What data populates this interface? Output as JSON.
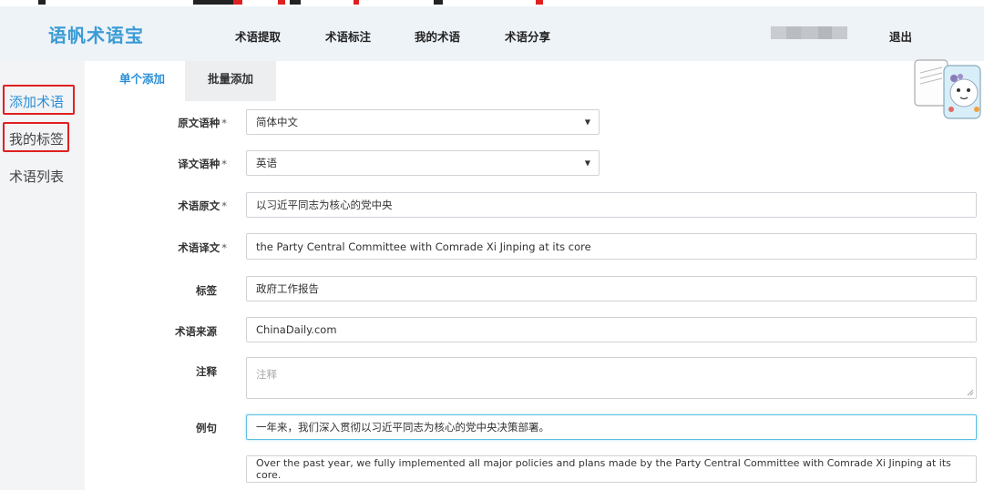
{
  "header": {
    "logo": "语帆术语宝",
    "nav": [
      "术语提取",
      "术语标注",
      "我的术语",
      "术语分享"
    ],
    "logout": "退出"
  },
  "sidebar": {
    "items": [
      {
        "label": "添加术语",
        "active": true,
        "highlighted": true
      },
      {
        "label": "我的标签",
        "active": false,
        "highlighted": true
      },
      {
        "label": "术语列表",
        "active": false,
        "highlighted": false
      }
    ]
  },
  "tabs": [
    {
      "label": "单个添加",
      "active": true
    },
    {
      "label": "批量添加",
      "active": false
    }
  ],
  "form": {
    "source_lang": {
      "label": "原文语种",
      "required": "*",
      "value": "简体中文"
    },
    "target_lang": {
      "label": "译文语种",
      "required": "*",
      "value": "英语"
    },
    "term_source": {
      "label": "术语原文",
      "required": "*",
      "value": "以习近平同志为核心的党中央"
    },
    "term_target": {
      "label": "术语译文",
      "required": "*",
      "value": "the Party Central Committee with Comrade Xi Jinping at its core"
    },
    "tag": {
      "label": "标签",
      "value": "政府工作报告"
    },
    "origin": {
      "label": "术语来源",
      "value": "ChinaDaily.com"
    },
    "note": {
      "label": "注释",
      "placeholder": "注释"
    },
    "example": {
      "label": "例句",
      "value_cn": "一年来，我们深入贯彻以习近平同志为核心的党中央决策部署。",
      "value_en": "Over the past year, we fully implemented all major policies and plans made by the Party Central Committee with Comrade Xi Jinping at its core."
    }
  },
  "colors": {
    "accent": "#2b8fd6",
    "logo": "#3a9bd5",
    "highlight_box": "#e02020",
    "header_bg": "#eef3f8"
  }
}
